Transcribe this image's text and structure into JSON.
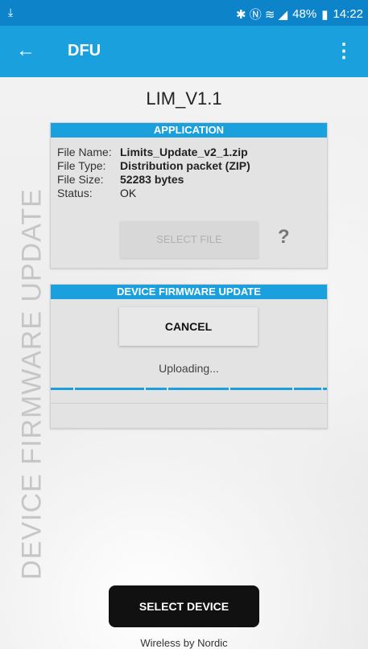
{
  "statusbar": {
    "download_icon": "download-icon",
    "icons": "✱ Ⓝ ≋ ◢",
    "battery": "48%",
    "time": "14:22"
  },
  "appbar": {
    "back_icon": "arrow-left-icon",
    "title": "DFU",
    "more_icon": "more-vert-icon"
  },
  "side_label": "DEVICE FIRMWARE UPDATE",
  "device_name": "LIM_V1.1",
  "application": {
    "header": "APPLICATION",
    "file_name_label": "File Name:",
    "file_name": "Limits_Update_v2_1.zip",
    "file_type_label": "File Type:",
    "file_type": "Distribution packet (ZIP)",
    "file_size_label": "File Size:",
    "file_size": "52283 bytes",
    "status_label": "Status:",
    "status": "OK",
    "select_file": "SELECT FILE",
    "help": "?"
  },
  "dfu": {
    "header": "DEVICE FIRMWARE UPDATE",
    "cancel": "CANCEL",
    "status": "Uploading...",
    "progress": 1.0
  },
  "select_device": "SELECT DEVICE",
  "footer": "Wireless by Nordic",
  "colors": {
    "accent": "#1aa0dd",
    "statusbar": "#0d84c9"
  }
}
